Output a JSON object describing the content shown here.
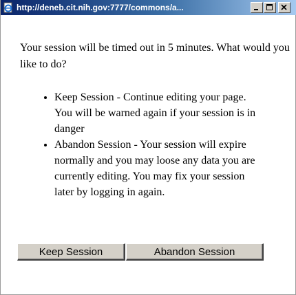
{
  "window": {
    "title": "http://deneb.cit.nih.gov:7777/commons/a...",
    "icon": "ie-page-icon",
    "controls": {
      "minimize": "minimize-icon",
      "maximize": "maximize-icon",
      "close": "close-icon"
    }
  },
  "dialog": {
    "message": "Your session will be timed out in 5 minutes. What would you like to do?",
    "options": [
      {
        "text": "Keep Session - Continue editing your page. You will be warned again if your session is in danger"
      },
      {
        "text": "Abandon Session - Your session will expire normally and you may loose any data you are currently editing. You may fix your session later by logging in again."
      }
    ],
    "buttons": {
      "keep_label": "Keep Session",
      "abandon_label": "Abandon Session"
    }
  },
  "colors": {
    "titlebar_start": "#0a246a",
    "titlebar_end": "#a6caf0",
    "button_face": "#d4d0c8"
  }
}
